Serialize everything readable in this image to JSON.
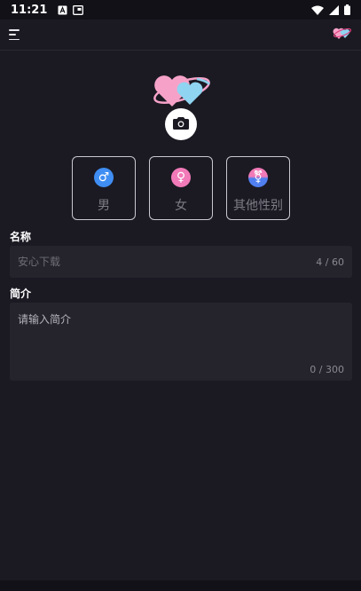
{
  "status_bar": {
    "time": "11:21",
    "left_icons": [
      "font-a-icon",
      "screenshot-icon"
    ],
    "right_icons": [
      "wifi-icon",
      "signal-icon",
      "battery-icon"
    ]
  },
  "app_bar": {
    "menu_icon": "menu-icon",
    "logo_icon": "hearts-logo-icon"
  },
  "avatar": {
    "logo_icon": "hearts-logo-icon",
    "camera_icon": "camera-icon"
  },
  "gender_options": [
    {
      "label": "男",
      "symbol": "♂",
      "icon": "male-icon",
      "color": "#3f8ef3"
    },
    {
      "label": "女",
      "symbol": "♀",
      "icon": "female-icon",
      "color": "#f27ab8"
    },
    {
      "label": "其他性别",
      "symbol": "⚧",
      "icon": "transgender-icon",
      "color": "#8f6fe0"
    }
  ],
  "name_section": {
    "label": "名称",
    "value": "安心下载",
    "counter": "4 / 60"
  },
  "bio_section": {
    "label": "简介",
    "placeholder": "请输入简介",
    "counter": "0 / 300"
  },
  "colors": {
    "background": "#1b1a23",
    "field_background": "#25242c",
    "heart_pink": "#f6a2c8",
    "heart_blue": "#8fd4f0"
  }
}
